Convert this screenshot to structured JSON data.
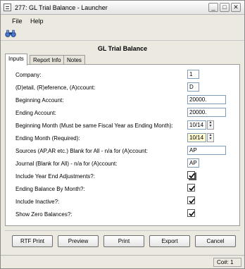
{
  "window": {
    "title": "277: GL Trial Balance - Launcher",
    "controls": [
      "_",
      "□",
      "✕"
    ]
  },
  "menu": {
    "items": [
      "File",
      "Help"
    ]
  },
  "toolbar": {
    "icon": "binoculars-icon"
  },
  "report_title": "GL Trial Balance",
  "tabs": [
    {
      "label": "Inputs",
      "active": true
    },
    {
      "label": "Report Info",
      "active": false
    },
    {
      "label": "Notes",
      "active": false
    }
  ],
  "fields": {
    "company": {
      "label": "Company:",
      "value": "1"
    },
    "detail": {
      "label": "(D)etail, (R)eference, (A)ccount:",
      "value": "D"
    },
    "beginning_account": {
      "label": "Beginning Account:",
      "value": "20000."
    },
    "ending_account": {
      "label": "Ending Account:",
      "value": "20000."
    },
    "beginning_month": {
      "label": "Beginning Month (Must be same Fiscal Year as Ending Month):",
      "value": "10/14"
    },
    "ending_month": {
      "label": "Ending Month (Required):",
      "value": "10/14"
    },
    "sources": {
      "label": "Sources (AP,AR etc.) Blank for All - n/a for (A)ccount:",
      "value": "AP"
    },
    "journal": {
      "label": "Journal (Blank for All) - n/a for (A)ccount:",
      "value": "AP"
    }
  },
  "checkboxes": {
    "year_end": {
      "label": "Include Year End Adjustments?:",
      "checked": true
    },
    "by_month": {
      "label": "Ending Balance By Month?:",
      "checked": true
    },
    "inactive": {
      "label": "Include Inactive?:",
      "checked": true
    },
    "zero_balances": {
      "label": "Show Zero Balances?:",
      "checked": true
    }
  },
  "buttons": {
    "rtf_print": "RTF Print",
    "preview": "Preview",
    "print": "Print",
    "export": "Export",
    "cancel": "Cancel"
  },
  "status": {
    "company": "Co#: 1"
  },
  "colors": {
    "highlight_field": "#fdf9d0",
    "field_border": "#7f9db9"
  }
}
